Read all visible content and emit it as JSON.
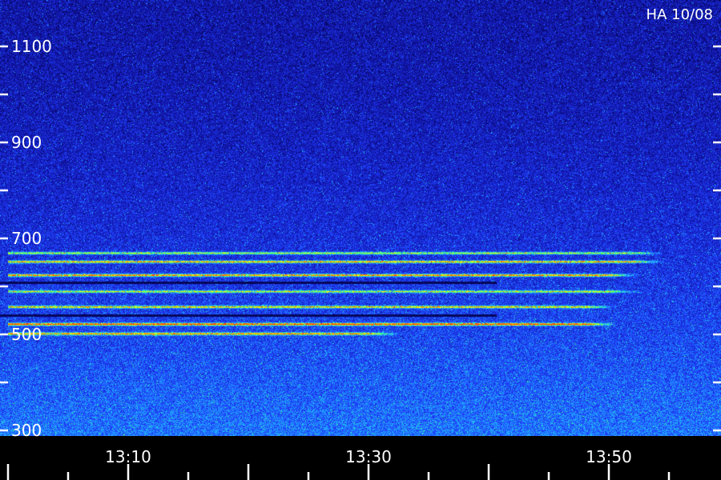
{
  "title": "HA 10/08",
  "chart_data": {
    "type": "heatmap",
    "title": "HA 10/08",
    "xlabel": "",
    "ylabel": "",
    "x_tick_labels": [
      "13:10",
      "13:30",
      "13:50"
    ],
    "x_ticks_minutes": [
      10,
      30,
      50
    ],
    "x_range_minutes": [
      0,
      60
    ],
    "y_tick_labels": [
      "1100",
      "900",
      "700",
      "500",
      "300"
    ],
    "y_ticks": [
      1100,
      1000,
      900,
      800,
      700,
      600,
      500,
      400,
      300
    ],
    "ylim": [
      300,
      1130
    ],
    "colormap": [
      "#000022",
      "#1010a0",
      "#2040ff",
      "#20c0ff",
      "#40ff80",
      "#ffff00",
      "#ff4000"
    ],
    "bands": [
      {
        "y": 670,
        "intensity": 0.55,
        "x_range_minutes": [
          0,
          52
        ]
      },
      {
        "y": 652,
        "intensity": 0.7,
        "x_range_minutes": [
          0,
          52
        ]
      },
      {
        "y": 624,
        "intensity": 0.75,
        "x_range_minutes": [
          0,
          50
        ]
      },
      {
        "y": 590,
        "intensity": 0.55,
        "x_range_minutes": [
          0,
          50
        ]
      },
      {
        "y": 558,
        "intensity": 0.65,
        "x_range_minutes": [
          0,
          48
        ]
      },
      {
        "y": 522,
        "intensity": 0.85,
        "x_range_minutes": [
          0,
          48
        ]
      },
      {
        "y": 502,
        "intensity": 0.7,
        "x_range_minutes": [
          0,
          30
        ]
      }
    ],
    "dark_lines": [
      {
        "y": 540
      },
      {
        "y": 608
      }
    ]
  }
}
